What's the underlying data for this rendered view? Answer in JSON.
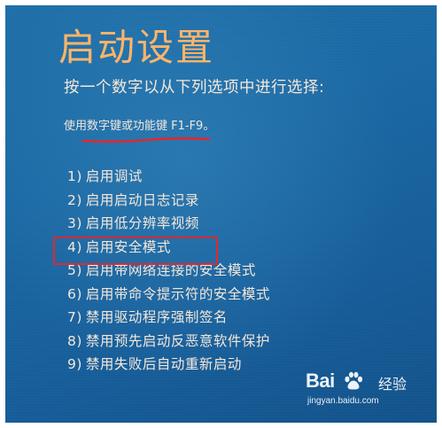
{
  "screen": {
    "title": "启动设置",
    "instruction": "按一个数字以从下列选项中进行选择:",
    "hint": "使用数字键或功能键 F1-F9。",
    "options": [
      {
        "num": "1)",
        "label": "启用调试"
      },
      {
        "num": "2)",
        "label": "启用启动日志记录"
      },
      {
        "num": "3)",
        "label": "启用低分辨率视频"
      },
      {
        "num": "4)",
        "label": "启用安全模式"
      },
      {
        "num": "5)",
        "label": "启用带网络连接的安全模式"
      },
      {
        "num": "6)",
        "label": "启用带命令提示符的安全模式"
      },
      {
        "num": "7)",
        "label": "禁用驱动程序强制签名"
      },
      {
        "num": "8)",
        "label": "禁用预先启动反恶意软件保护"
      },
      {
        "num": "9)",
        "label": "禁用失败后自动重新启动"
      }
    ],
    "highlighted_option_index": 3
  },
  "watermark": {
    "brand_left": "Bai",
    "brand_right": "",
    "brand_cn": "经验",
    "url": "jingyan.baidu.com",
    "icon": "baidu-paw-icon"
  },
  "colors": {
    "background": "#1a68a4",
    "title": "#ffb468",
    "text": "#f5e7d8",
    "annotation_red": "#e2262c"
  }
}
